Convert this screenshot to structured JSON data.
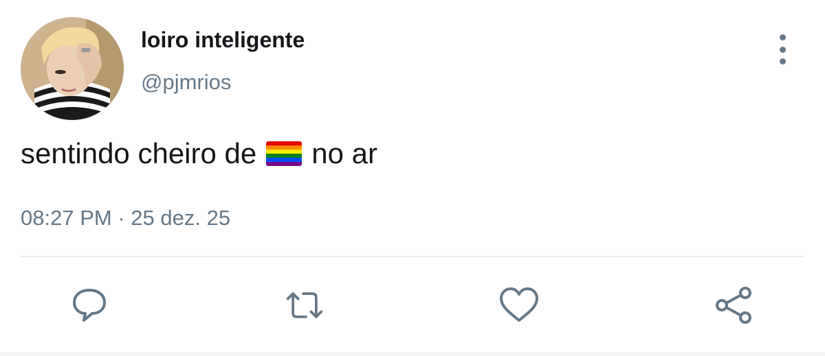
{
  "tweet": {
    "display_name": "loiro inteligente",
    "handle": "@pjmrios",
    "text_before": "sentindo cheiro de",
    "emoji": "rainbow-flag",
    "text_after": "no ar",
    "time": "08:27 PM",
    "separator": "·",
    "date": "25 dez. 25"
  },
  "icons": {
    "more": "more-vertical-icon",
    "reply": "reply-icon",
    "retweet": "retweet-icon",
    "like": "heart-icon",
    "share": "share-icon"
  },
  "colors": {
    "text_primary": "#14171a",
    "text_secondary": "#657786",
    "divider": "#e6ecf0",
    "flag": [
      "#e40303",
      "#ff8c00",
      "#ffed00",
      "#008026",
      "#004dff",
      "#750787"
    ]
  }
}
